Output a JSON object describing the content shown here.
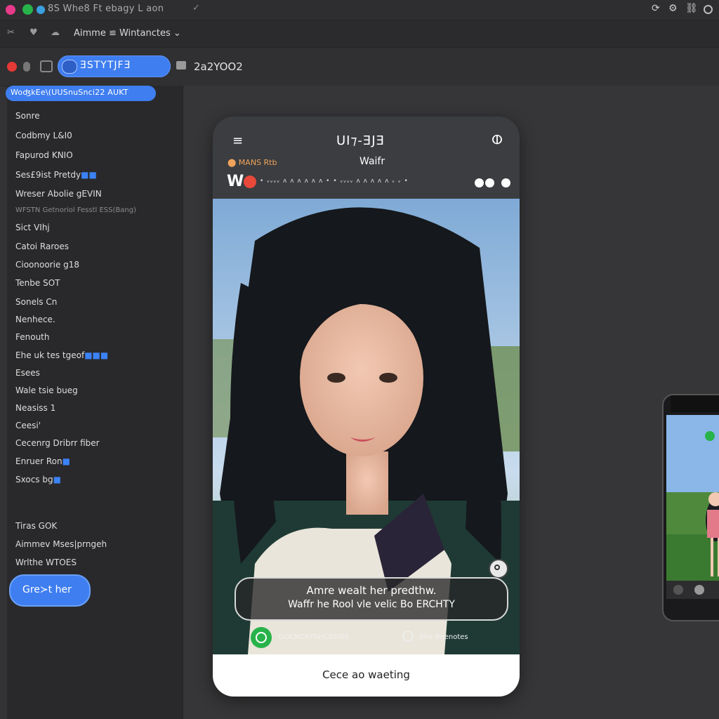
{
  "window": {
    "title": "8S Whe8 Ft ebagy  L aon",
    "check": "✓"
  },
  "toolbar": {
    "text": "Aimme ≌ Wintanctes ⌄"
  },
  "tabs": {
    "active_pill": "ƎSTYTJFƎ",
    "tab_text": "2a2YOO2"
  },
  "sidebar": {
    "chip": "WoʤkEe\\(UUSnuSnci22 AUKT",
    "items": [
      {
        "label": "Sonre"
      },
      {
        "label": "Codbmy L&I0"
      },
      {
        "label": "Fapurod KNIO"
      },
      {
        "label": "Ses£9ist Pretdy",
        "badge": "■■"
      },
      {
        "label": "Wreser Abolie gEVIN"
      },
      {
        "label": "WFSTN Getnoriol Fesstl ESS(Bang)",
        "dim": true
      },
      {
        "label": "Sict VIhj"
      },
      {
        "label": "Catoi Raroes"
      },
      {
        "label": "Cioonoorie g18"
      },
      {
        "label": "Tenbe SOT"
      },
      {
        "label": "Sonels Cn"
      },
      {
        "label": "Nenhece."
      },
      {
        "label": "Fenouth"
      },
      {
        "label": "Ehe uk tes tgeof",
        "badge": "■■■"
      },
      {
        "label": "Esees"
      },
      {
        "label": "Wale tsie bueg"
      },
      {
        "label": "Neasiss 1"
      },
      {
        "label": "Ceesi'"
      },
      {
        "label": "Cecenrg Dribrr fiber"
      },
      {
        "label": "Enruer Ron",
        "badge": "■"
      },
      {
        "label": "Sxocs bg",
        "badge": "■"
      },
      {
        "label": "Tiras GOK"
      },
      {
        "label": "Aimmev Mses|prngeh"
      },
      {
        "label": "Wrlthe  WTOES"
      }
    ],
    "button": "Gre≻t her"
  },
  "phone": {
    "menu_icon": "≡",
    "title": "UI⁊-ƎJƎ",
    "action_icon": "ⵀ",
    "sub_left": "⬤ MANS Rtb",
    "sub_title": "Waifr",
    "brand_letter": "W",
    "story_dots": "• ᵥᵥᵥᵥ ᴧ ᴧ ᴧ ᴧ ᴧ ᴧ • • ᵥᵥᵥᵥ ᴧ ᴧ ᴧ ᴧ ᴧ ᵥ ᵥ •",
    "caption_line1": "Amre wealt her predthw.",
    "caption_line2": "Waffr he Rool vle velic Bo ERCHTY",
    "meta_left": "DOCNCRFSHCSSNIS",
    "meta_right": "Bhe Bnenotes",
    "footer": "Cece ao waeting"
  },
  "colors": {
    "accent": "#3f7ef0",
    "background": "#333335",
    "sidebar": "#29292b",
    "green": "#27b34a",
    "red": "#e8493a"
  }
}
